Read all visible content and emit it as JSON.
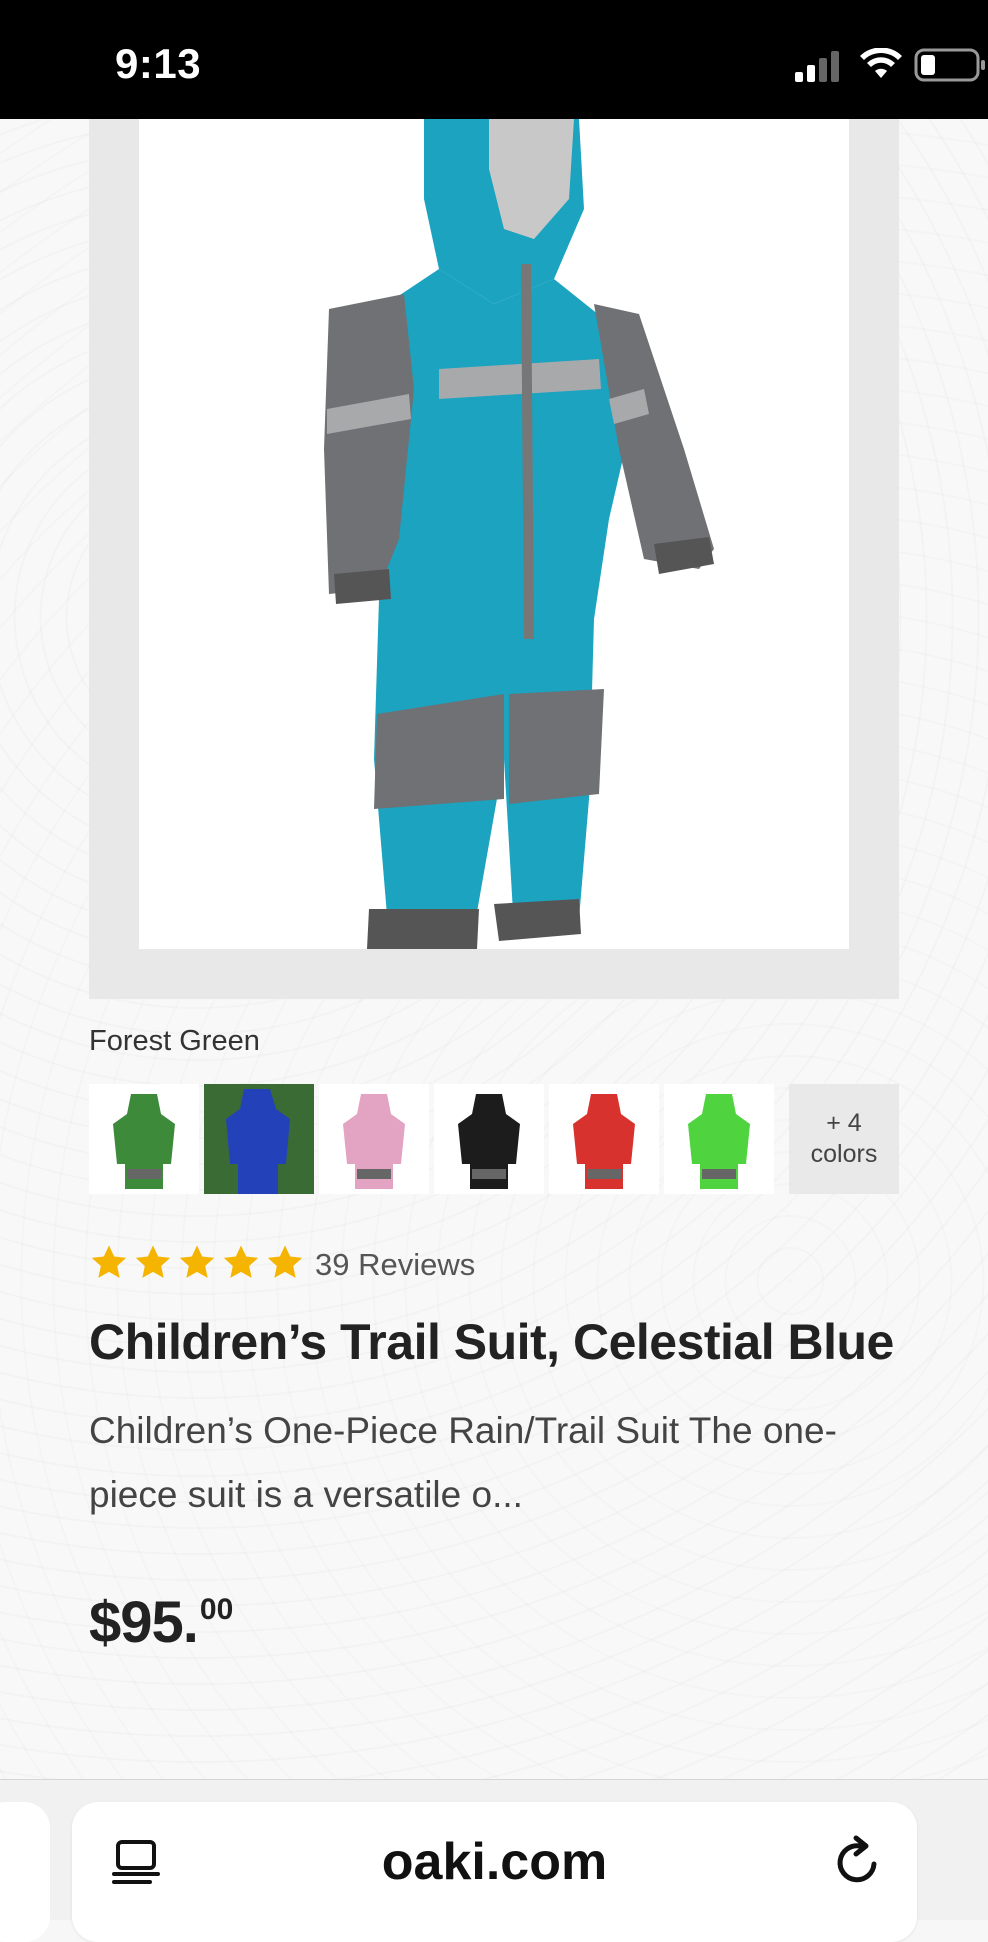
{
  "status_bar": {
    "time": "9:13",
    "icons": [
      "cellular-signal-icon",
      "wifi-icon",
      "battery-icon"
    ]
  },
  "product": {
    "image_alt": "Children's one-piece trail suit in celestial blue with grey panels",
    "selected_color_label": "Forest Green",
    "swatches": [
      {
        "name": "green",
        "color": "#3d8a3a"
      },
      {
        "name": "royal-blue",
        "color": "#2341b8"
      },
      {
        "name": "pink",
        "color": "#e3a3c2"
      },
      {
        "name": "black",
        "color": "#1c1c1c"
      },
      {
        "name": "red",
        "color": "#d7322d"
      },
      {
        "name": "lime-green",
        "color": "#4fd33e"
      }
    ],
    "more_colors_line1": "+ 4",
    "more_colors_line2": "colors",
    "rating": {
      "stars": 5,
      "star_color": "#f4b400"
    },
    "review_count": "39 Reviews",
    "title": "Children’s Trail Suit, Celestial Blue",
    "description": "Children’s One-Piece Rain/Trail Suit  The one-piece suit is a versatile o...",
    "price_main": "$95.",
    "price_cents": "00"
  },
  "browser": {
    "url": "oaki.com",
    "accent": "#111111"
  }
}
